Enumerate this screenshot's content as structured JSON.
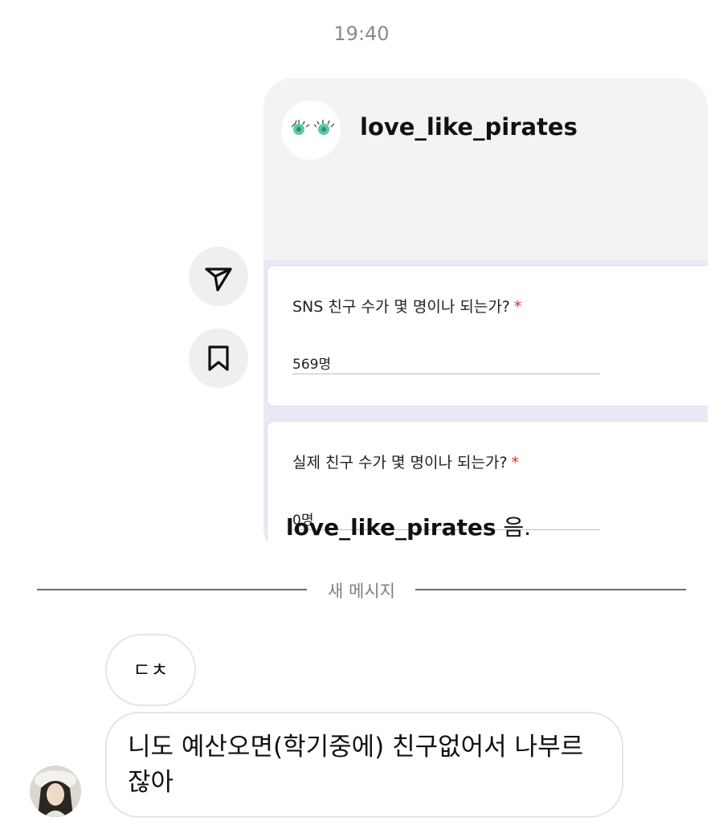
{
  "timestamp": "19:40",
  "shared_post": {
    "username": "love_like_pirates",
    "questions": [
      {
        "text": "SNS 친구 수가 몇 명이나 되는가?",
        "required_mark": "*",
        "answer": "569명"
      },
      {
        "text": "실제 친구 수가 몇 명이나 되는가?",
        "required_mark": "*",
        "answer": "0명"
      }
    ],
    "caption_user": "love_like_pirates",
    "caption_text": " 음."
  },
  "divider_text": "새 메시지",
  "messages": [
    {
      "text": "ㄷㅊ"
    },
    {
      "text": "니도 예산오면(학기중에) 친구없어서 나부르 잖아"
    }
  ],
  "icons": {
    "share": "send-icon",
    "save": "bookmark-icon",
    "card_avatar": "eyes-avatar",
    "user_avatar": "profile-photo"
  }
}
